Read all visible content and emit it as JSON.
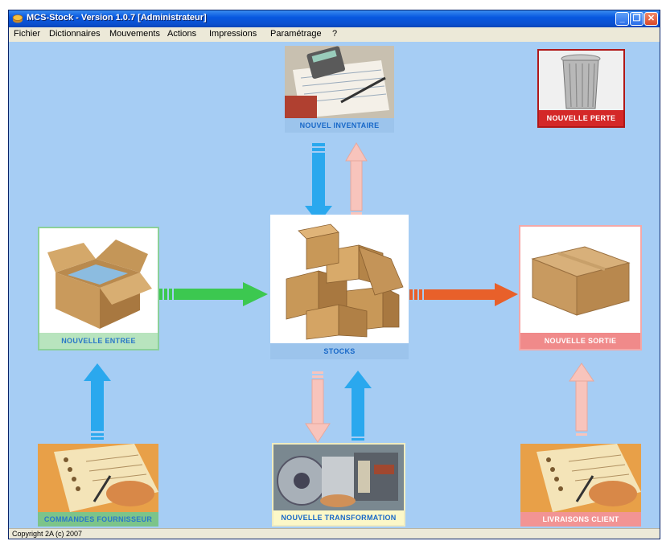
{
  "window": {
    "title": "MCS-Stock - Version 1.0.7 [Administrateur]",
    "minimize_glyph": "_",
    "restore_glyph": "❐",
    "close_glyph": "✕"
  },
  "menu": {
    "items": [
      "Fichier",
      "Dictionnaires",
      "Mouvements",
      "Actions",
      "Impressions",
      "Paramétrage",
      "?"
    ]
  },
  "tiles": {
    "inventaire": "NOUVEL INVENTAIRE",
    "perte": "NOUVELLE PERTE",
    "entree": "NOUVELLE ENTREE",
    "stocks": "STOCKS",
    "sortie": "NOUVELLE SORTIE",
    "commandes": "COMMANDES FOURNISSEUR",
    "transformation": "NOUVELLE TRANSFORMATION",
    "livraisons": "LIVRAISONS CLIENT"
  },
  "status": {
    "copyright": "Copyright 2A (c) 2007"
  },
  "colors": {
    "background": "#a6cdf4",
    "arrow_blue": "#2aa8ee",
    "arrow_pink": "#f8c4bc",
    "arrow_green": "#3cc850",
    "arrow_orange": "#e8602a",
    "label_perte": "#d42828",
    "label_sortie": "#f08a8a",
    "label_commandes": "#7cc48a"
  }
}
